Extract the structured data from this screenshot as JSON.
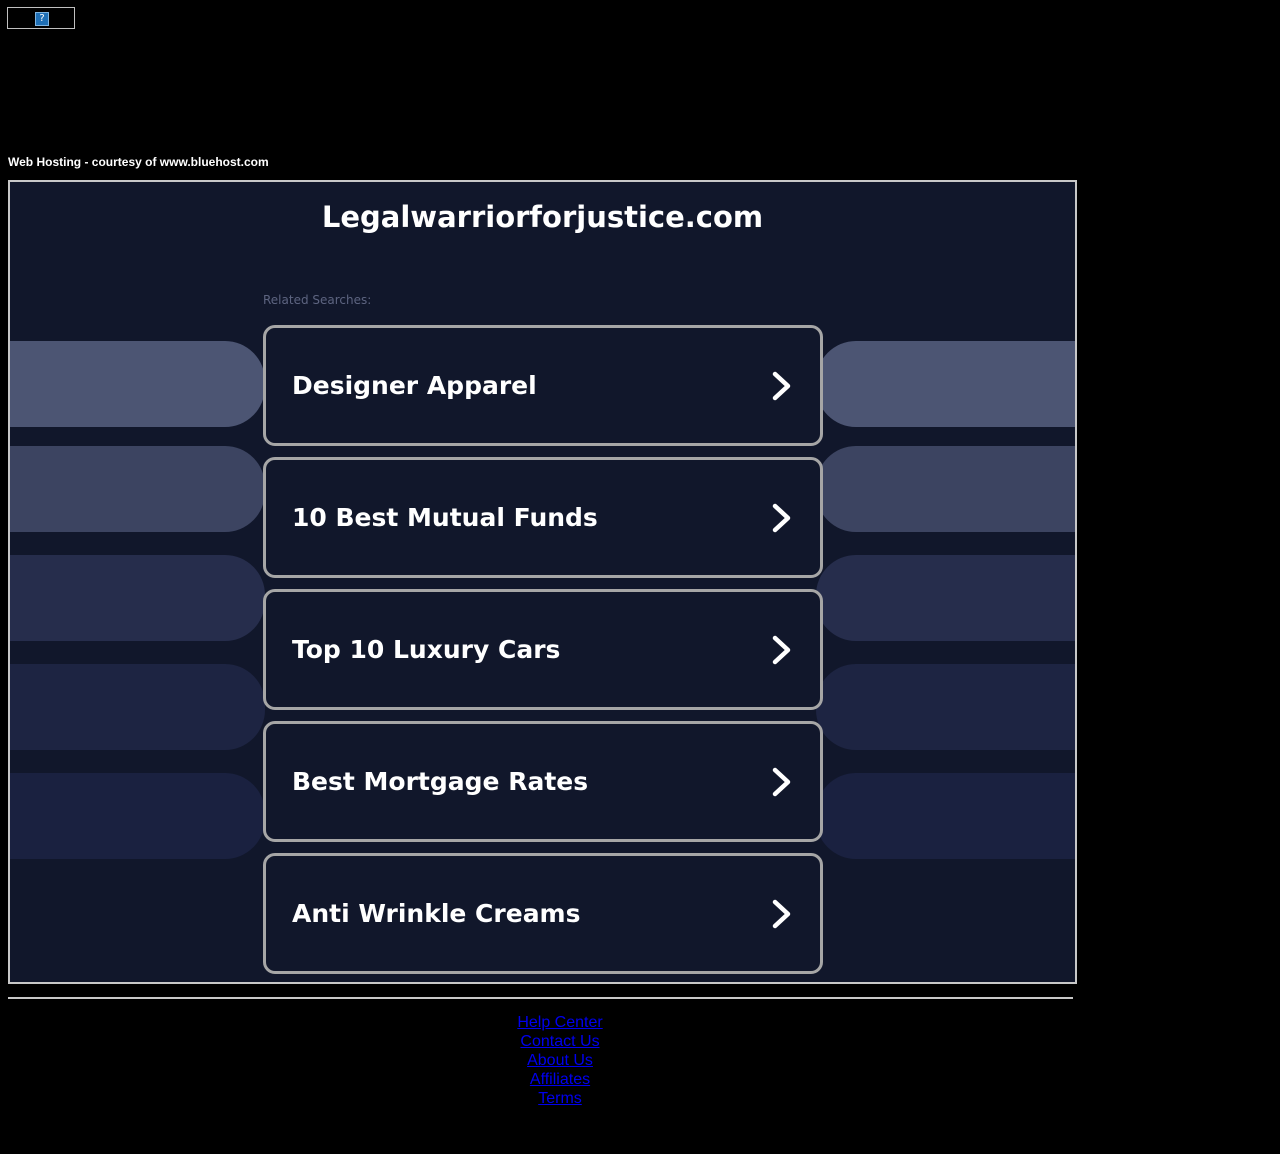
{
  "top_banner": {
    "image_icon": "broken-image-icon",
    "glyph": "?"
  },
  "hosting_text": "Web Hosting - courtesy of www.bluehost.com",
  "main": {
    "domain_title": "Legalwarriorforjustice.com",
    "related_label": "Related Searches:",
    "searches": [
      {
        "label": "Designer Apparel",
        "icon": "chevron-right-icon"
      },
      {
        "label": "10 Best Mutual Funds",
        "icon": "chevron-right-icon"
      },
      {
        "label": "Top 10 Luxury Cars",
        "icon": "chevron-right-icon"
      },
      {
        "label": "Best Mortgage Rates",
        "icon": "chevron-right-icon"
      },
      {
        "label": "Anti Wrinkle Creams",
        "icon": "chevron-right-icon"
      }
    ]
  },
  "footer": {
    "links": [
      "Help Center",
      "Contact Us",
      "About Us",
      "Affiliates",
      "Terms"
    ]
  },
  "colors": {
    "page_background": "#000000",
    "panel_background": "#11172b",
    "card_border": "#a6a6a6",
    "footer_link": "#0000ee",
    "side_pill_shades": [
      "#4c5573",
      "#3c4461",
      "#262d4c",
      "#1d2442",
      "#1a2140"
    ]
  }
}
